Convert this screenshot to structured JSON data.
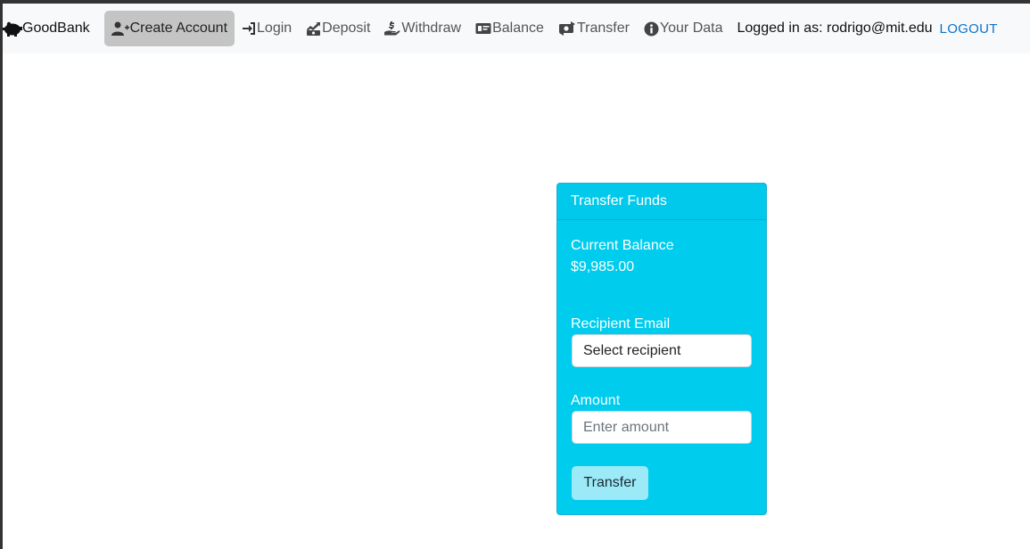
{
  "navbar": {
    "brand": {
      "label": "GoodBank",
      "icon": "piggy-bank-icon"
    },
    "items": [
      {
        "label": "Create Account",
        "icon": "user-plus-icon",
        "active": true
      },
      {
        "label": "Login",
        "icon": "sign-in-icon",
        "active": false
      },
      {
        "label": "Deposit",
        "icon": "deposit-icon",
        "active": false
      },
      {
        "label": "Withdraw",
        "icon": "hand-holding-dollar-icon",
        "active": false
      },
      {
        "label": "Balance",
        "icon": "money-check-icon",
        "active": false
      },
      {
        "label": "Transfer",
        "icon": "money-transfer-icon",
        "active": false
      },
      {
        "label": "Your Data",
        "icon": "info-circle-icon",
        "active": false
      }
    ],
    "logged_in_text": "Logged in as: rodrigo@mit.edu",
    "logout_label": "LOGOUT"
  },
  "card": {
    "header": "Transfer Funds",
    "balance_title": "Current Balance",
    "balance_value": "$9,985.00",
    "recipient_label": "Recipient Email",
    "recipient_value": "Select recipient",
    "amount_label": "Amount",
    "amount_placeholder": "Enter amount",
    "submit_label": "Transfer"
  },
  "colors": {
    "card_bg": "#00ccee",
    "navbar_bg": "#f8f9fa",
    "active_nav_bg": "#c4c4c4",
    "logout": "#0a73c9",
    "button_bg": "#9ceaf7"
  }
}
